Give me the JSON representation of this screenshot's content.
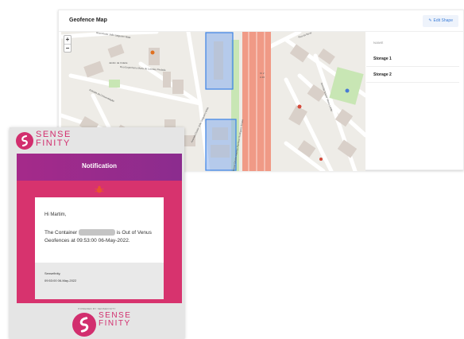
{
  "geofence": {
    "title": "Geofence Map",
    "edit_button": "Edit Shape",
    "zoom_in": "+",
    "zoom_out": "−",
    "list_header": "NAME",
    "items": [
      {
        "label": "Storage 1"
      },
      {
        "label": "Storage 2"
      }
    ],
    "map_labels": {
      "street1": "Rua Doutor João Salgueiro Maia",
      "street2": "Rua Engenheiro Maria de Lourdes Piedade",
      "street3": "Estrada da Circunvalação",
      "street4": "Avenida Doutor João Salgueiro Maia",
      "street5": "Rua Professor Doutor António Pacheco Rodrigues Sousa",
      "street6": "Rua da Nova",
      "street7": "Avenida Doutor Vasco Leitão",
      "garden": "Jardim da Cidade",
      "route": "IC 2",
      "route2": "A 20"
    },
    "colors": {
      "geofence_fill": "#8fb4ef",
      "geofence_stroke": "#3b82e6",
      "highway": "#f09a86",
      "park": "#c8e6b4",
      "accent": "#3b7dd8"
    }
  },
  "email": {
    "logo_line1": "SENSE",
    "logo_line2": "FINITY",
    "header": "Notification",
    "greeting": "Hi Martim,",
    "text_before": "The Container",
    "text_after": "is Out of Venus Geofences at 09:53:00 06-May-2022.",
    "sign_name": "Sensefinity,",
    "sign_time": "09:53:00 06-May-2022",
    "powered": "POWERED BY SENSEFINITY",
    "colors": {
      "brand": "#d22e6e",
      "header": "#9b2b8c",
      "body": "#d7336e"
    }
  }
}
